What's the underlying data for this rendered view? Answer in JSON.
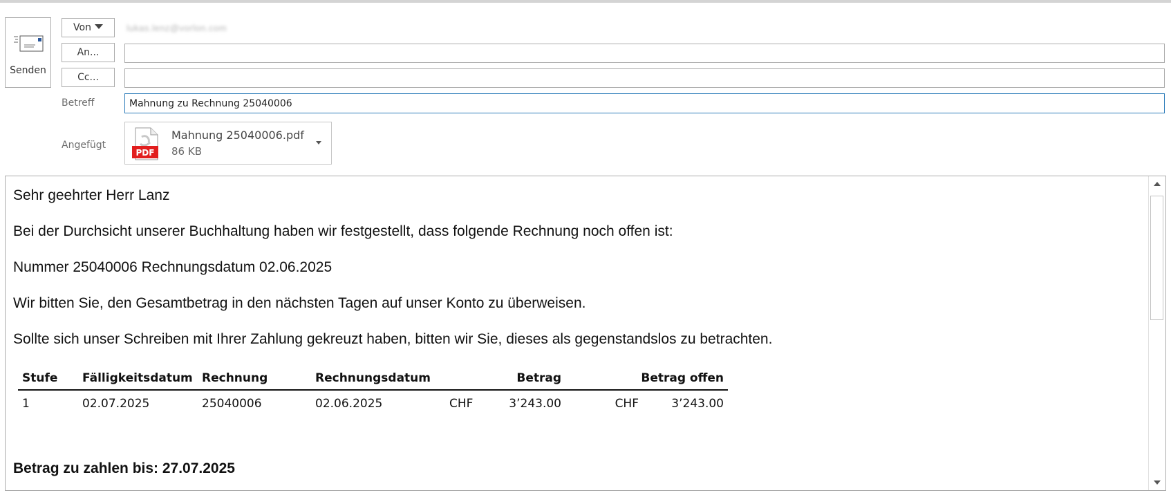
{
  "compose": {
    "send_label": "Senden",
    "from_button": "Von",
    "from_value": "lukas.lenz@vorlon.com",
    "to_button": "An...",
    "to_value": "",
    "cc_button": "Cc...",
    "cc_value": "",
    "subject_label": "Betreff",
    "subject_value": "Mahnung zu Rechnung 25040006",
    "attached_label": "Angefügt",
    "attachment": {
      "name": "Mahnung 25040006.pdf",
      "size": "86 KB",
      "icon_text": "PDF"
    }
  },
  "body": {
    "greeting": "Sehr geehrter Herr Lanz",
    "p1": "Bei der Durchsicht unserer Buchhaltung haben wir festgestellt, dass folgende Rechnung noch offen ist:",
    "p2": "Nummer 25040006 Rechnungsdatum 02.06.2025",
    "p3": "Wir bitten Sie, den Gesamtbetrag in den nächsten Tagen auf unser Konto zu überweisen.",
    "p4": "Sollte sich unser Schreiben mit Ihrer Zahlung gekreuzt haben, bitten wir Sie, dieses als gegenstandslos zu betrachten.",
    "table": {
      "headers": [
        "Stufe",
        "Fälligkeitsdatum",
        "Rechnung",
        "Rechnungsdatum",
        "Betrag",
        "Betrag offen"
      ],
      "row": {
        "stufe": "1",
        "faellig": "02.07.2025",
        "rechnung": "25040006",
        "rdatum": "02.06.2025",
        "currency1": "CHF",
        "betrag": "3’243.00",
        "currency2": "CHF",
        "offen": "3’243.00"
      }
    },
    "due_line": "Betrag zu zahlen bis: 27.07.2025"
  },
  "colors": {
    "focus_border": "#2b7bb9",
    "pdf_red": "#e21e1e"
  }
}
